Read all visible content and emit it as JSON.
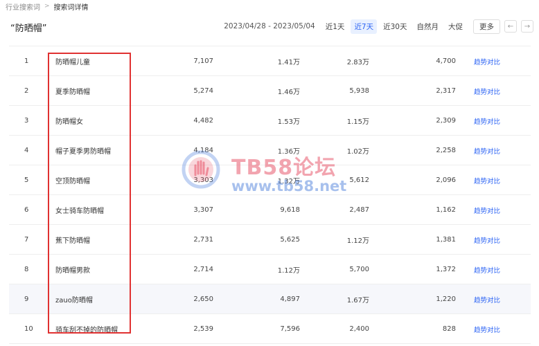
{
  "breadcrumb": {
    "parent": "行业搜索词",
    "separator": ">",
    "current": "搜索词详情"
  },
  "page_title": "“防晒帽”",
  "toolbar": {
    "date_range": "2023/04/28 - 2023/05/04",
    "range_tabs": [
      "近1天",
      "近7天",
      "近30天",
      "自然月",
      "大促"
    ],
    "active_tab": "近7天",
    "more_label": "更多",
    "prev_icon": "←",
    "next_icon": "→"
  },
  "rows": [
    {
      "rank": "1",
      "keyword": "防晒帽儿童",
      "v1": "7,107",
      "v2": "1.41万",
      "v3": "2.83万",
      "v4": "4,700",
      "action": "趋势对比"
    },
    {
      "rank": "2",
      "keyword": "夏季防晒帽",
      "v1": "5,274",
      "v2": "1.46万",
      "v3": "5,938",
      "v4": "2,317",
      "action": "趋势对比"
    },
    {
      "rank": "3",
      "keyword": "防晒帽女",
      "v1": "4,482",
      "v2": "1.53万",
      "v3": "1.15万",
      "v4": "2,309",
      "action": "趋势对比"
    },
    {
      "rank": "4",
      "keyword": "帽子夏季男防晒帽",
      "v1": "4,184",
      "v2": "1.36万",
      "v3": "1.02万",
      "v4": "2,258",
      "action": "趋势对比"
    },
    {
      "rank": "5",
      "keyword": "空顶防晒帽",
      "v1": "3,303",
      "v2": "1.32万",
      "v3": "5,612",
      "v4": "2,096",
      "action": "趋势对比"
    },
    {
      "rank": "6",
      "keyword": "女士骑车防晒帽",
      "v1": "3,307",
      "v2": "9,618",
      "v3": "2,487",
      "v4": "1,162",
      "action": "趋势对比"
    },
    {
      "rank": "7",
      "keyword": "蕉下防晒帽",
      "v1": "2,731",
      "v2": "5,625",
      "v3": "1.12万",
      "v4": "1,381",
      "action": "趋势对比"
    },
    {
      "rank": "8",
      "keyword": "防晒帽男款",
      "v1": "2,714",
      "v2": "1.12万",
      "v3": "5,700",
      "v4": "1,372",
      "action": "趋势对比"
    },
    {
      "rank": "9",
      "keyword": "zauo防晒帽",
      "v1": "2,650",
      "v2": "4,897",
      "v3": "1.67万",
      "v4": "1,220",
      "action": "趋势对比"
    },
    {
      "rank": "10",
      "keyword": "骑车刮不掉的防晒帽",
      "v1": "2,539",
      "v2": "7,596",
      "v3": "2,400",
      "v4": "828",
      "action": "趋势对比"
    }
  ],
  "watermark": {
    "line1": "TB58论坛",
    "line2": "www.tb58.net"
  },
  "colors": {
    "accent": "#2a62f4",
    "highlight": "#e03131",
    "active_tab_bg": "#e8f0ff"
  }
}
